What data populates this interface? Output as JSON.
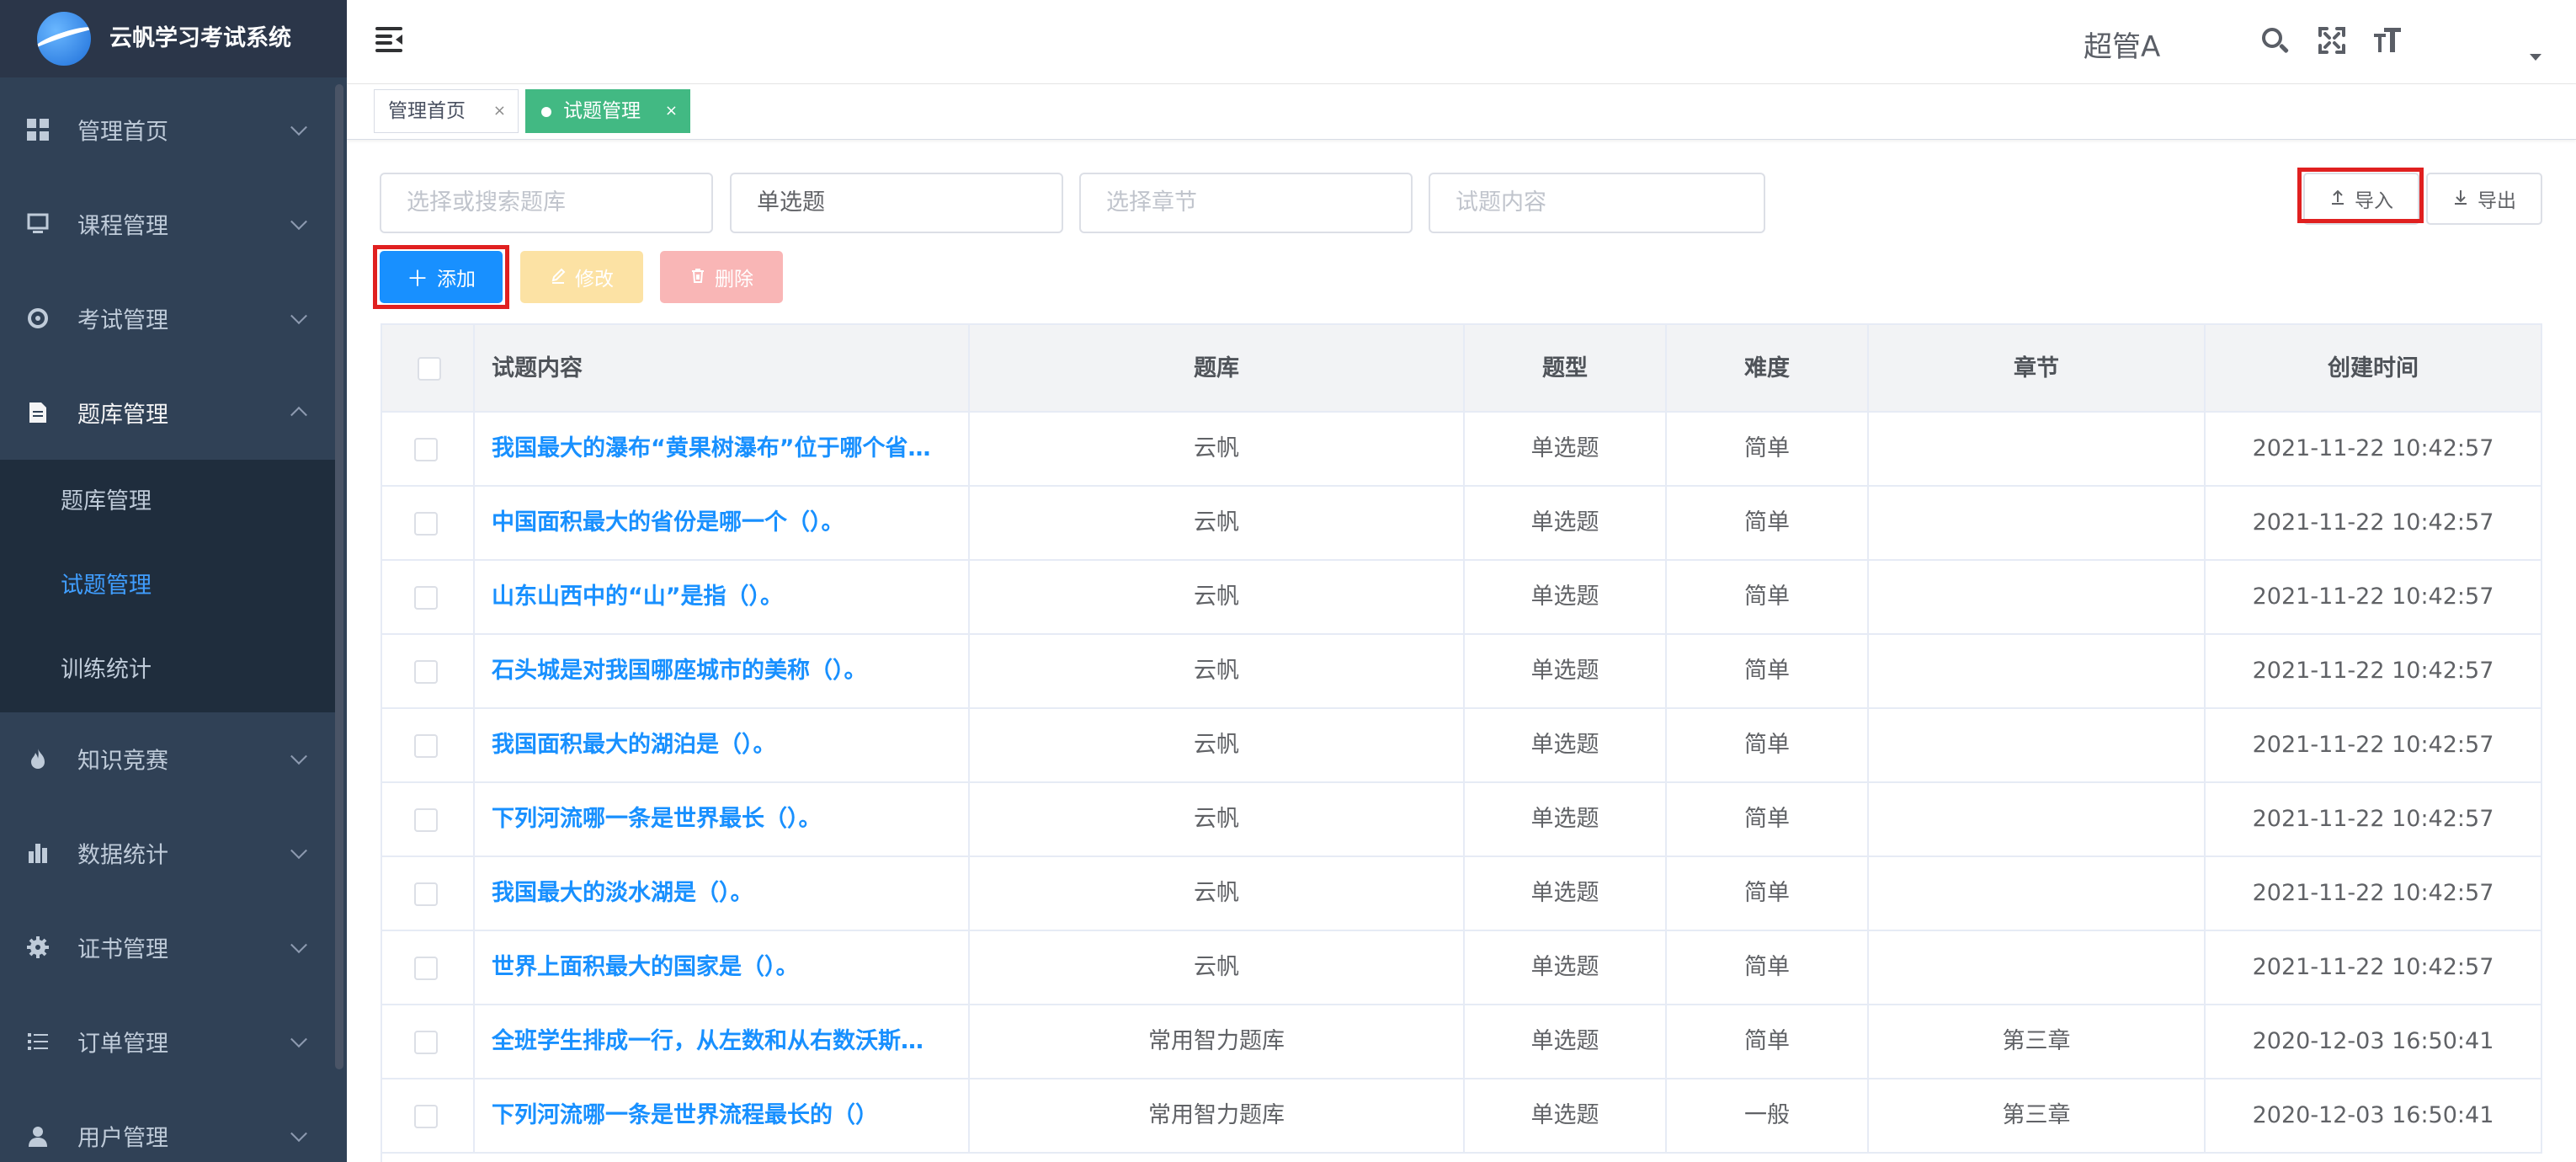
{
  "app": {
    "title": "云帆学习考试系统"
  },
  "sidebar": {
    "items": [
      {
        "label": "管理首页",
        "icon": "dashboard-icon"
      },
      {
        "label": "课程管理",
        "icon": "course-icon"
      },
      {
        "label": "考试管理",
        "icon": "exam-icon"
      },
      {
        "label": "题库管理",
        "icon": "question-bank-icon",
        "expanded": true
      },
      {
        "label": "知识竞赛",
        "icon": "fire-icon"
      },
      {
        "label": "数据统计",
        "icon": "bar-chart-icon"
      },
      {
        "label": "证书管理",
        "icon": "certificate-icon"
      },
      {
        "label": "订单管理",
        "icon": "list-icon"
      },
      {
        "label": "用户管理",
        "icon": "user-icon"
      }
    ],
    "submenu": [
      {
        "label": "题库管理",
        "active": false
      },
      {
        "label": "试题管理",
        "active": true
      },
      {
        "label": "训练统计",
        "active": false
      }
    ]
  },
  "header": {
    "user": "超管A"
  },
  "tags": [
    {
      "label": "管理首页",
      "close": "×",
      "active": false
    },
    {
      "label": "试题管理",
      "close": "×",
      "active": true
    }
  ],
  "filters": {
    "repo_placeholder": "选择或搜索题库",
    "type_value": "单选题",
    "chapter_placeholder": "选择章节",
    "content_placeholder": "试题内容"
  },
  "toolbar": {
    "import": "导入",
    "export": "导出",
    "add": "添加",
    "edit": "修改",
    "delete": "删除"
  },
  "table": {
    "headers": [
      "试题内容",
      "题库",
      "题型",
      "难度",
      "章节",
      "创建时间"
    ],
    "rows": [
      {
        "content": "我国最大的瀑布“黄果树瀑布”位于哪个省…",
        "repo": "云帆",
        "type": "单选题",
        "level": "简单",
        "chapter": "",
        "time": "2021-11-22 10:42:57"
      },
      {
        "content": "中国面积最大的省份是哪一个（）。",
        "repo": "云帆",
        "type": "单选题",
        "level": "简单",
        "chapter": "",
        "time": "2021-11-22 10:42:57"
      },
      {
        "content": "山东山西中的“山”是指（）。",
        "repo": "云帆",
        "type": "单选题",
        "level": "简单",
        "chapter": "",
        "time": "2021-11-22 10:42:57"
      },
      {
        "content": "石头城是对我国哪座城市的美称（）。",
        "repo": "云帆",
        "type": "单选题",
        "level": "简单",
        "chapter": "",
        "time": "2021-11-22 10:42:57"
      },
      {
        "content": "我国面积最大的湖泊是（）。",
        "repo": "云帆",
        "type": "单选题",
        "level": "简单",
        "chapter": "",
        "time": "2021-11-22 10:42:57"
      },
      {
        "content": "下列河流哪一条是世界最长（）。",
        "repo": "云帆",
        "type": "单选题",
        "level": "简单",
        "chapter": "",
        "time": "2021-11-22 10:42:57"
      },
      {
        "content": "我国最大的淡水湖是（）。",
        "repo": "云帆",
        "type": "单选题",
        "level": "简单",
        "chapter": "",
        "time": "2021-11-22 10:42:57"
      },
      {
        "content": "世界上面积最大的国家是（）。",
        "repo": "云帆",
        "type": "单选题",
        "level": "简单",
        "chapter": "",
        "time": "2021-11-22 10:42:57"
      },
      {
        "content": "全班学生排成一行，从左数和从右数沃斯…",
        "repo": "常用智力题库",
        "type": "单选题",
        "level": "简单",
        "chapter": "第三章",
        "time": "2020-12-03 16:50:41"
      },
      {
        "content": "下列河流哪一条是世界流程最长的（）",
        "repo": "常用智力题库",
        "type": "单选题",
        "level": "一般",
        "chapter": "第三章",
        "time": "2020-12-03 16:50:41"
      }
    ]
  },
  "colors": {
    "sidebar": "#304156",
    "primary": "#1890ff",
    "tag_active": "#42b983",
    "highlight": "#e02020"
  }
}
